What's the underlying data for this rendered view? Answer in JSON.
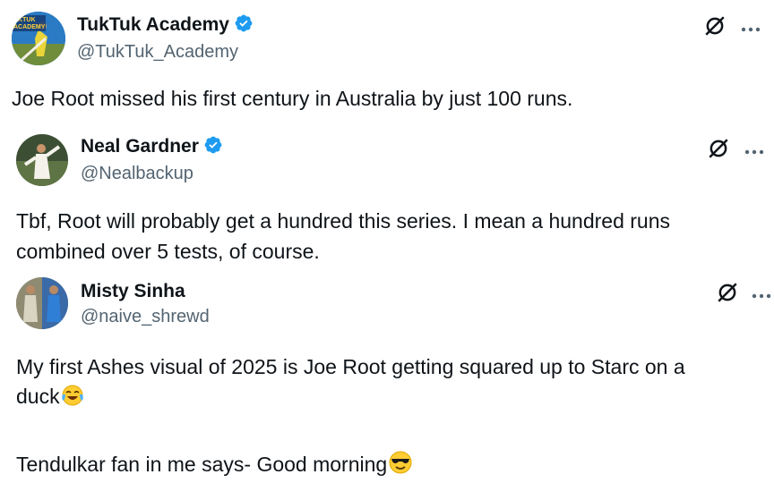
{
  "tweets": [
    {
      "name": "TukTuk Academy",
      "handle": "@TukTuk_Academy",
      "verified": true,
      "avatar_text": "UKTUK ACADEMY",
      "text_lines": [
        "Joe Root missed his first century in Australia by just 100 runs."
      ]
    },
    {
      "name": "Neal Gardner",
      "handle": "@Nealbackup",
      "verified": true,
      "text_lines": [
        "Tbf, Root will probably get a hundred this series. I mean a hundred runs",
        "combined over 5 tests, of course."
      ]
    },
    {
      "name": "Misty Sinha",
      "handle": "@naive_shrewd",
      "verified": false,
      "text_lines": [
        "My first Ashes visual of 2025 is Joe Root getting squared up to Starc on a",
        "duck",
        "Tendulkar fan in me says- Good morning"
      ]
    }
  ],
  "icons": {
    "verified": "verified-badge-icon",
    "grok": "grok-icon",
    "more": "more-icon",
    "crying_laughing": "tears-of-joy-emoji",
    "sunglasses": "sunglasses-emoji"
  },
  "colors": {
    "verified": "#1d9bf0",
    "text": "#0f1419",
    "secondary": "#536471"
  }
}
